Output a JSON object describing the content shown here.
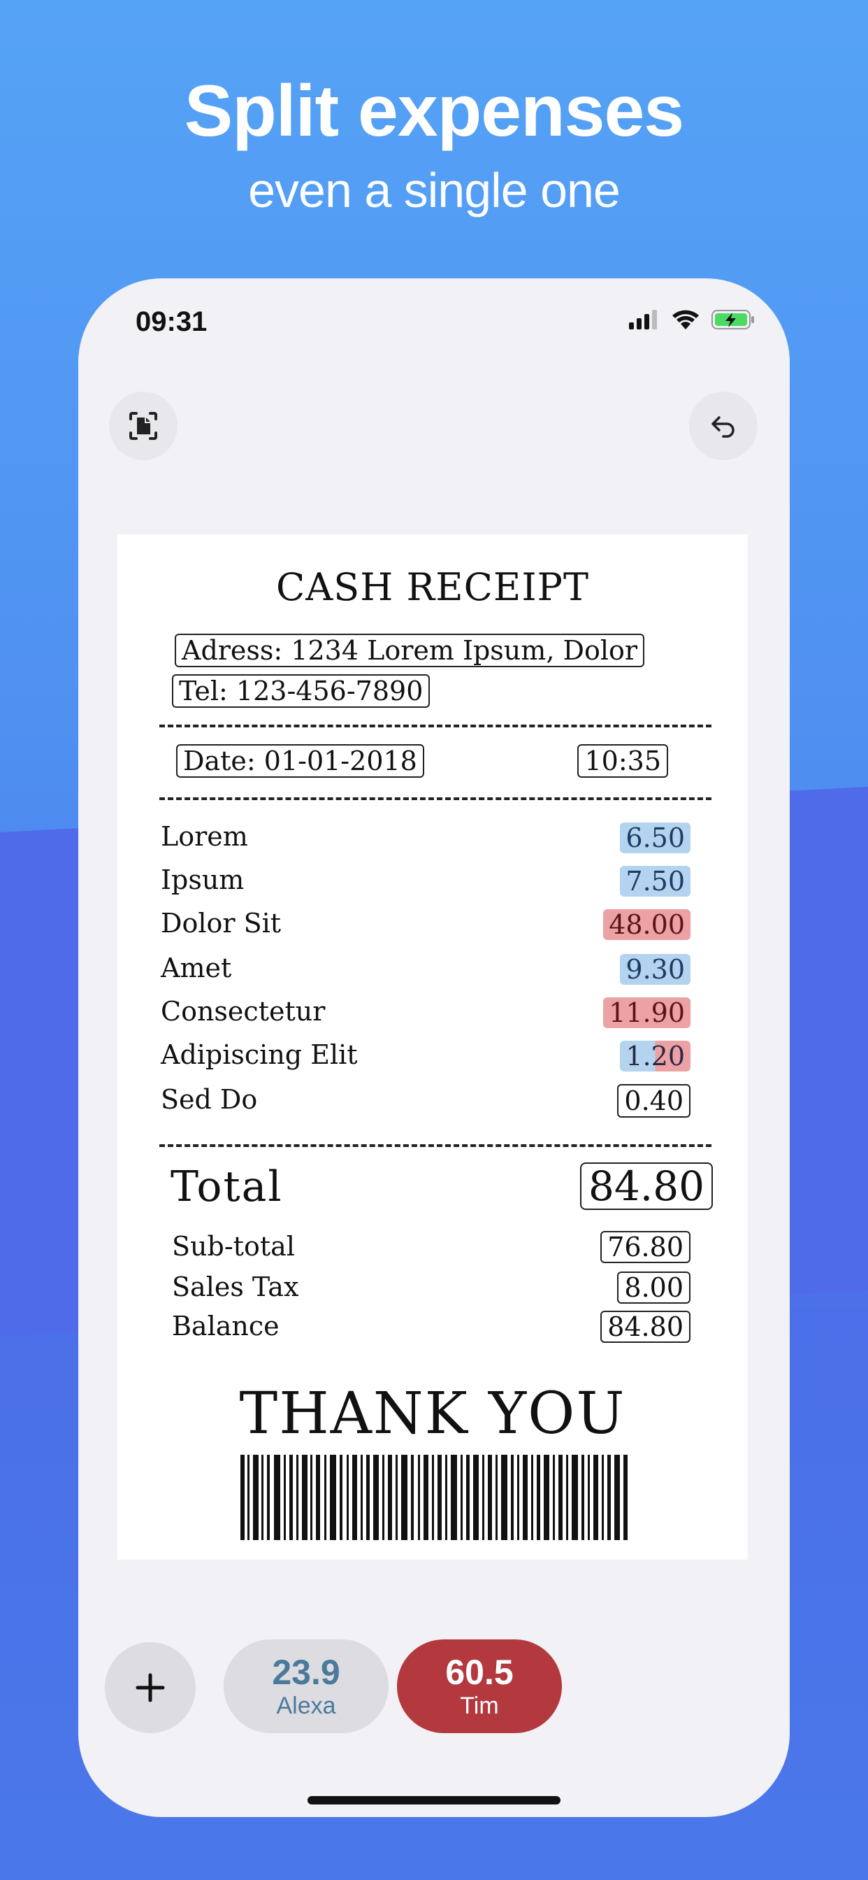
{
  "promo": {
    "headline": "Split expenses",
    "subheadline": "even a single one"
  },
  "status_bar": {
    "time": "09:31",
    "icons": [
      "signal-icon",
      "wifi-icon",
      "battery-charging-icon"
    ]
  },
  "toolbar": {
    "left_icon": "scan-document-icon",
    "right_icon": "undo-icon"
  },
  "receipt": {
    "title": "CASH RECEIPT",
    "address": "Adress: 1234 Lorem Ipsum, Dolor",
    "tel": "Tel: 123-456-7890",
    "date": "Date: 01-01-2018",
    "time": "10:35",
    "items": [
      {
        "name": "Lorem",
        "price": "6.50",
        "assigned": "blue"
      },
      {
        "name": "Ipsum",
        "price": "7.50",
        "assigned": "blue"
      },
      {
        "name": "Dolor Sit",
        "price": "48.00",
        "assigned": "red"
      },
      {
        "name": "Amet",
        "price": "9.30",
        "assigned": "blue"
      },
      {
        "name": "Consectetur",
        "price": "11.90",
        "assigned": "red"
      },
      {
        "name": "Adipiscing Elit",
        "price": "1.20",
        "assigned": "split"
      },
      {
        "name": "Sed Do",
        "price": "0.40",
        "assigned": "none"
      }
    ],
    "total_label": "Total",
    "total_value": "84.80",
    "subtotal_label": "Sub-total",
    "subtotal_value": "76.80",
    "tax_label": "Sales Tax",
    "tax_value": "8.00",
    "balance_label": "Balance",
    "balance_value": "84.80",
    "thanks": "THANK YOU"
  },
  "people": [
    {
      "amount": "23.9",
      "name": "Alexa",
      "color": "#4a7a9b"
    },
    {
      "amount": "60.5",
      "name": "Tim",
      "color": "#b3393f"
    }
  ],
  "add_button_icon": "plus-icon",
  "colors": {
    "accent_blue": "#b4d3ee",
    "accent_red": "#eca1a4",
    "tim_pill": "#b3393f",
    "alexa_text": "#4a7a9b"
  }
}
